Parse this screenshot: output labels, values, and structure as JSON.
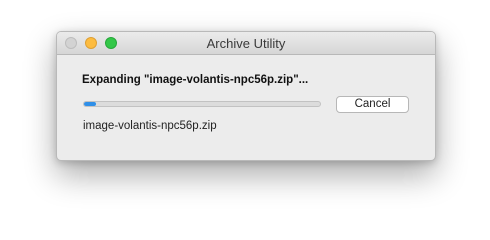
{
  "window": {
    "title": "Archive Utility"
  },
  "dialog": {
    "heading": "Expanding \"image-volantis-npc56p.zip\"...",
    "progress": 0.05,
    "cancel_label": "Cancel",
    "current_file": "image-volantis-npc56p.zip"
  },
  "colors": {
    "progress_fill": "#2f8fe8",
    "close_button": "#d3d3d3",
    "minimize_button": "#fdbc40",
    "zoom_button": "#33c748"
  }
}
